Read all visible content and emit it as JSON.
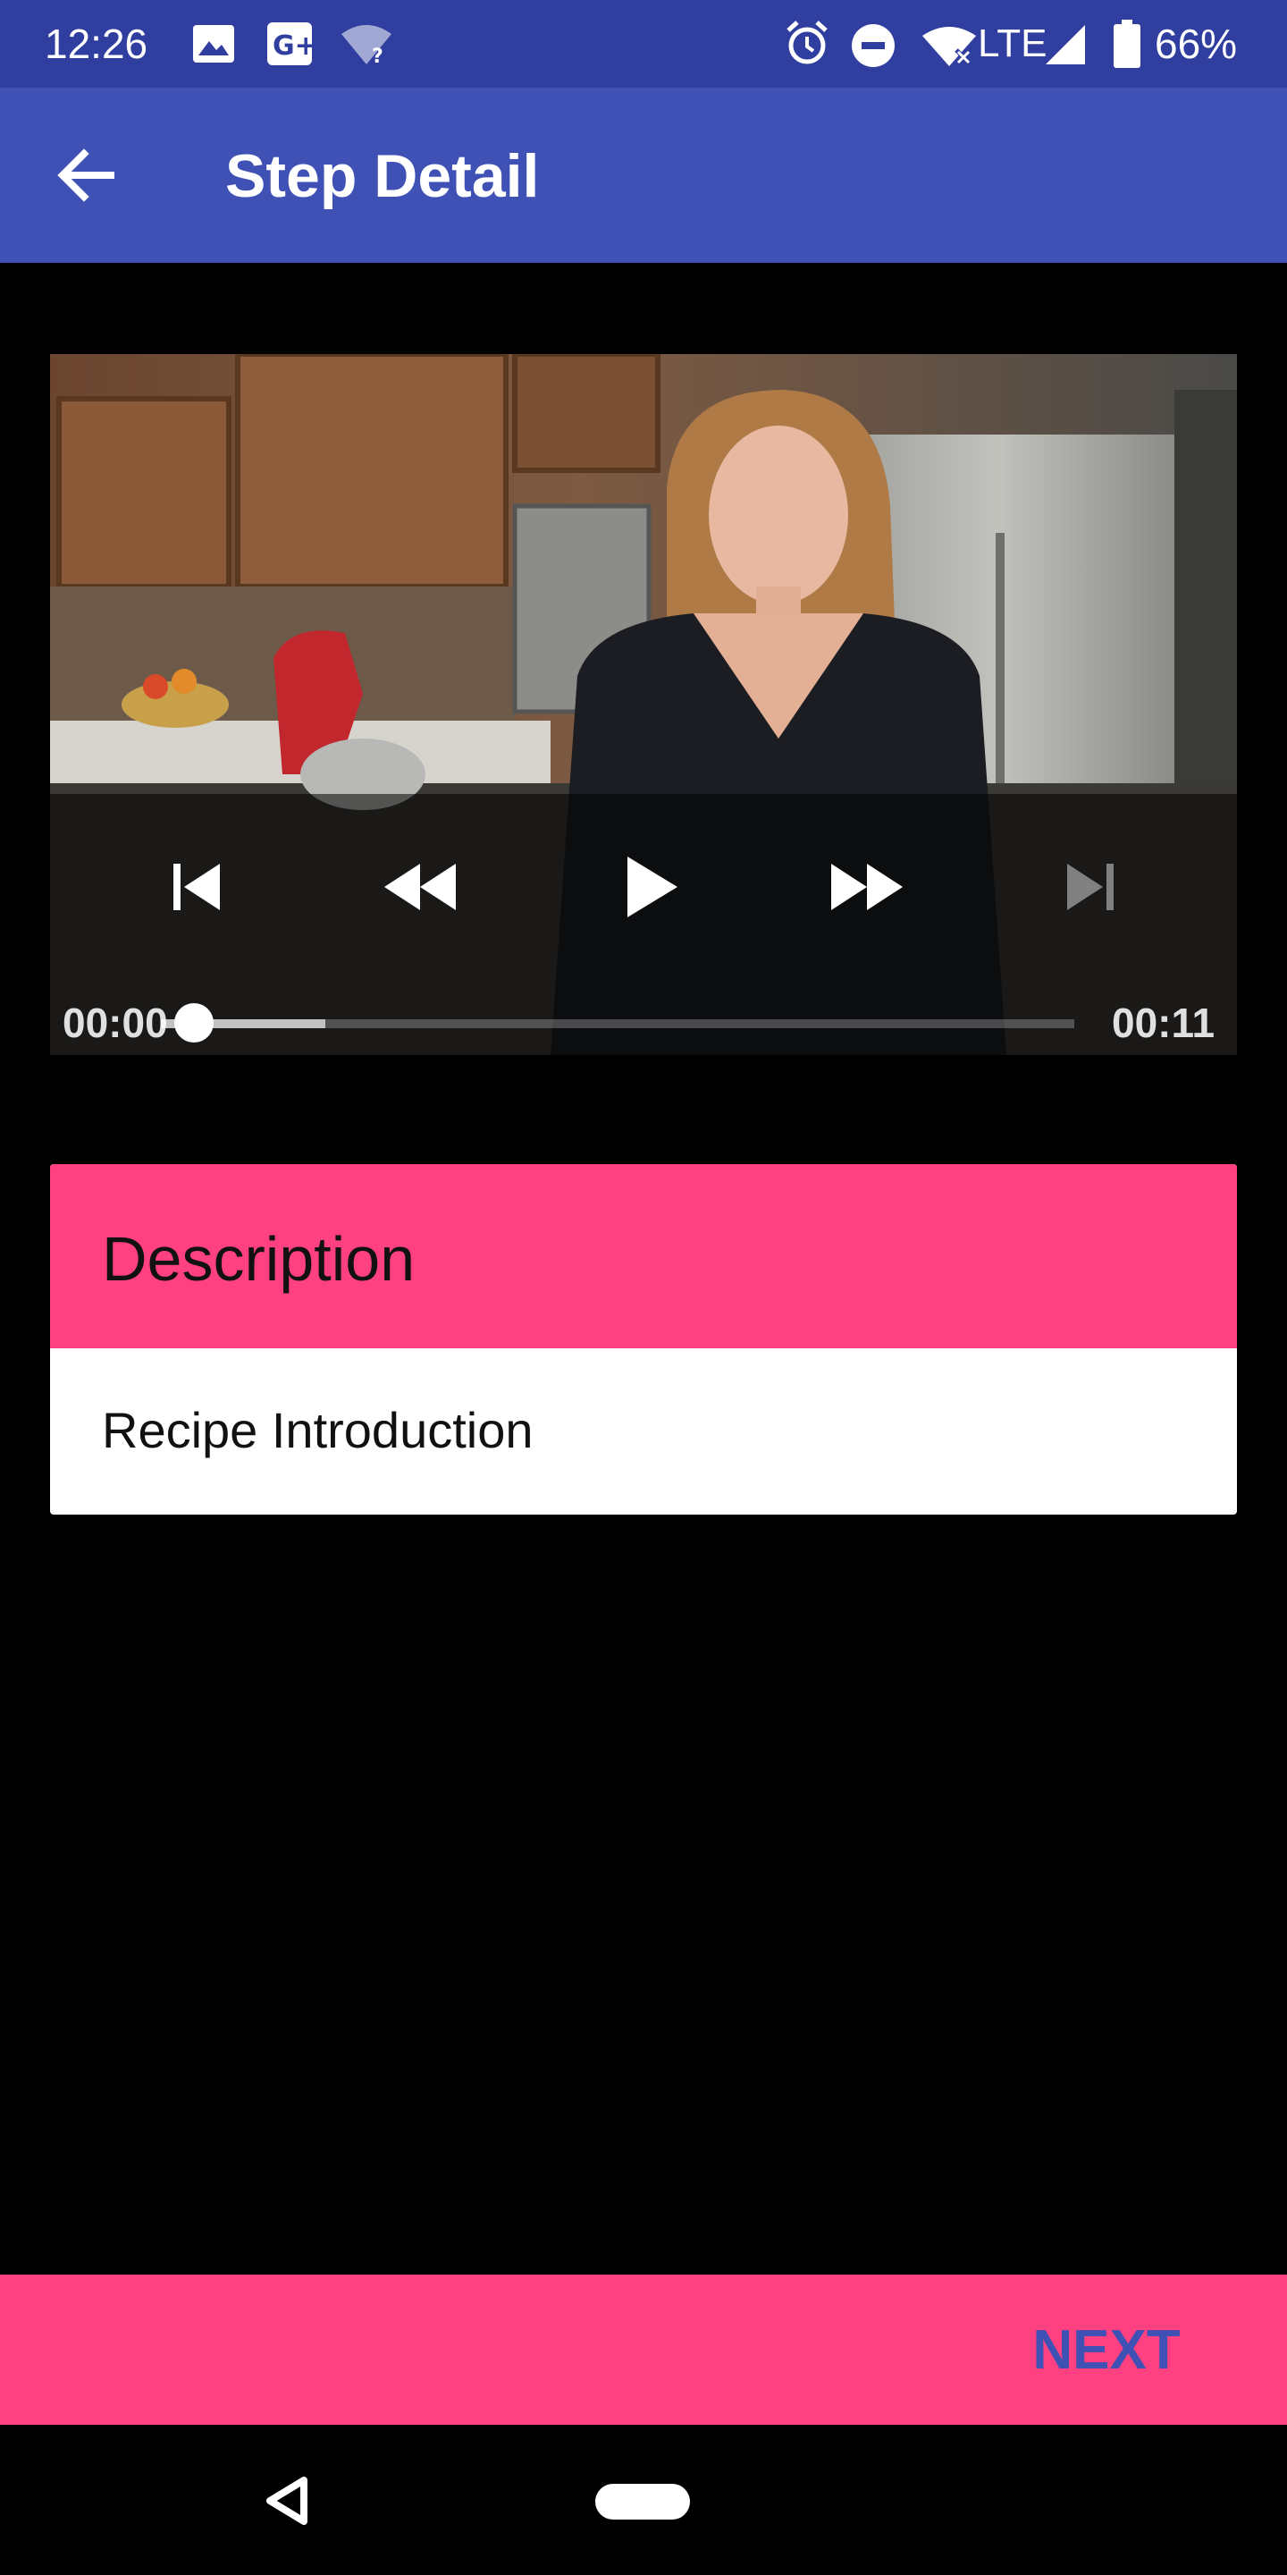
{
  "status_bar": {
    "time": "12:26",
    "network": "LTE",
    "battery": "66%",
    "icons": [
      "image-icon",
      "google-plus-icon",
      "wifi-question-icon",
      "alarm-icon",
      "do-not-disturb-icon",
      "wifi-off-icon",
      "signal-icon",
      "battery-icon"
    ]
  },
  "app_bar": {
    "title": "Step Detail",
    "back_icon": "arrow-left-icon",
    "color": "#3f51b5"
  },
  "video_player": {
    "current_time": "00:00",
    "duration": "00:11",
    "played_fraction": 0.0,
    "buffered_fraction": 0.18,
    "controls": [
      "skip-previous-icon",
      "rewind-icon",
      "play-icon",
      "fast-forward-icon",
      "skip-next-icon"
    ]
  },
  "description": {
    "header": "Description",
    "text": "Recipe Introduction",
    "accent": "#ff4081"
  },
  "bottom_bar": {
    "next_label": "NEXT"
  },
  "nav_bar": {
    "icons": [
      "nav-back-icon",
      "nav-home-pill"
    ]
  }
}
